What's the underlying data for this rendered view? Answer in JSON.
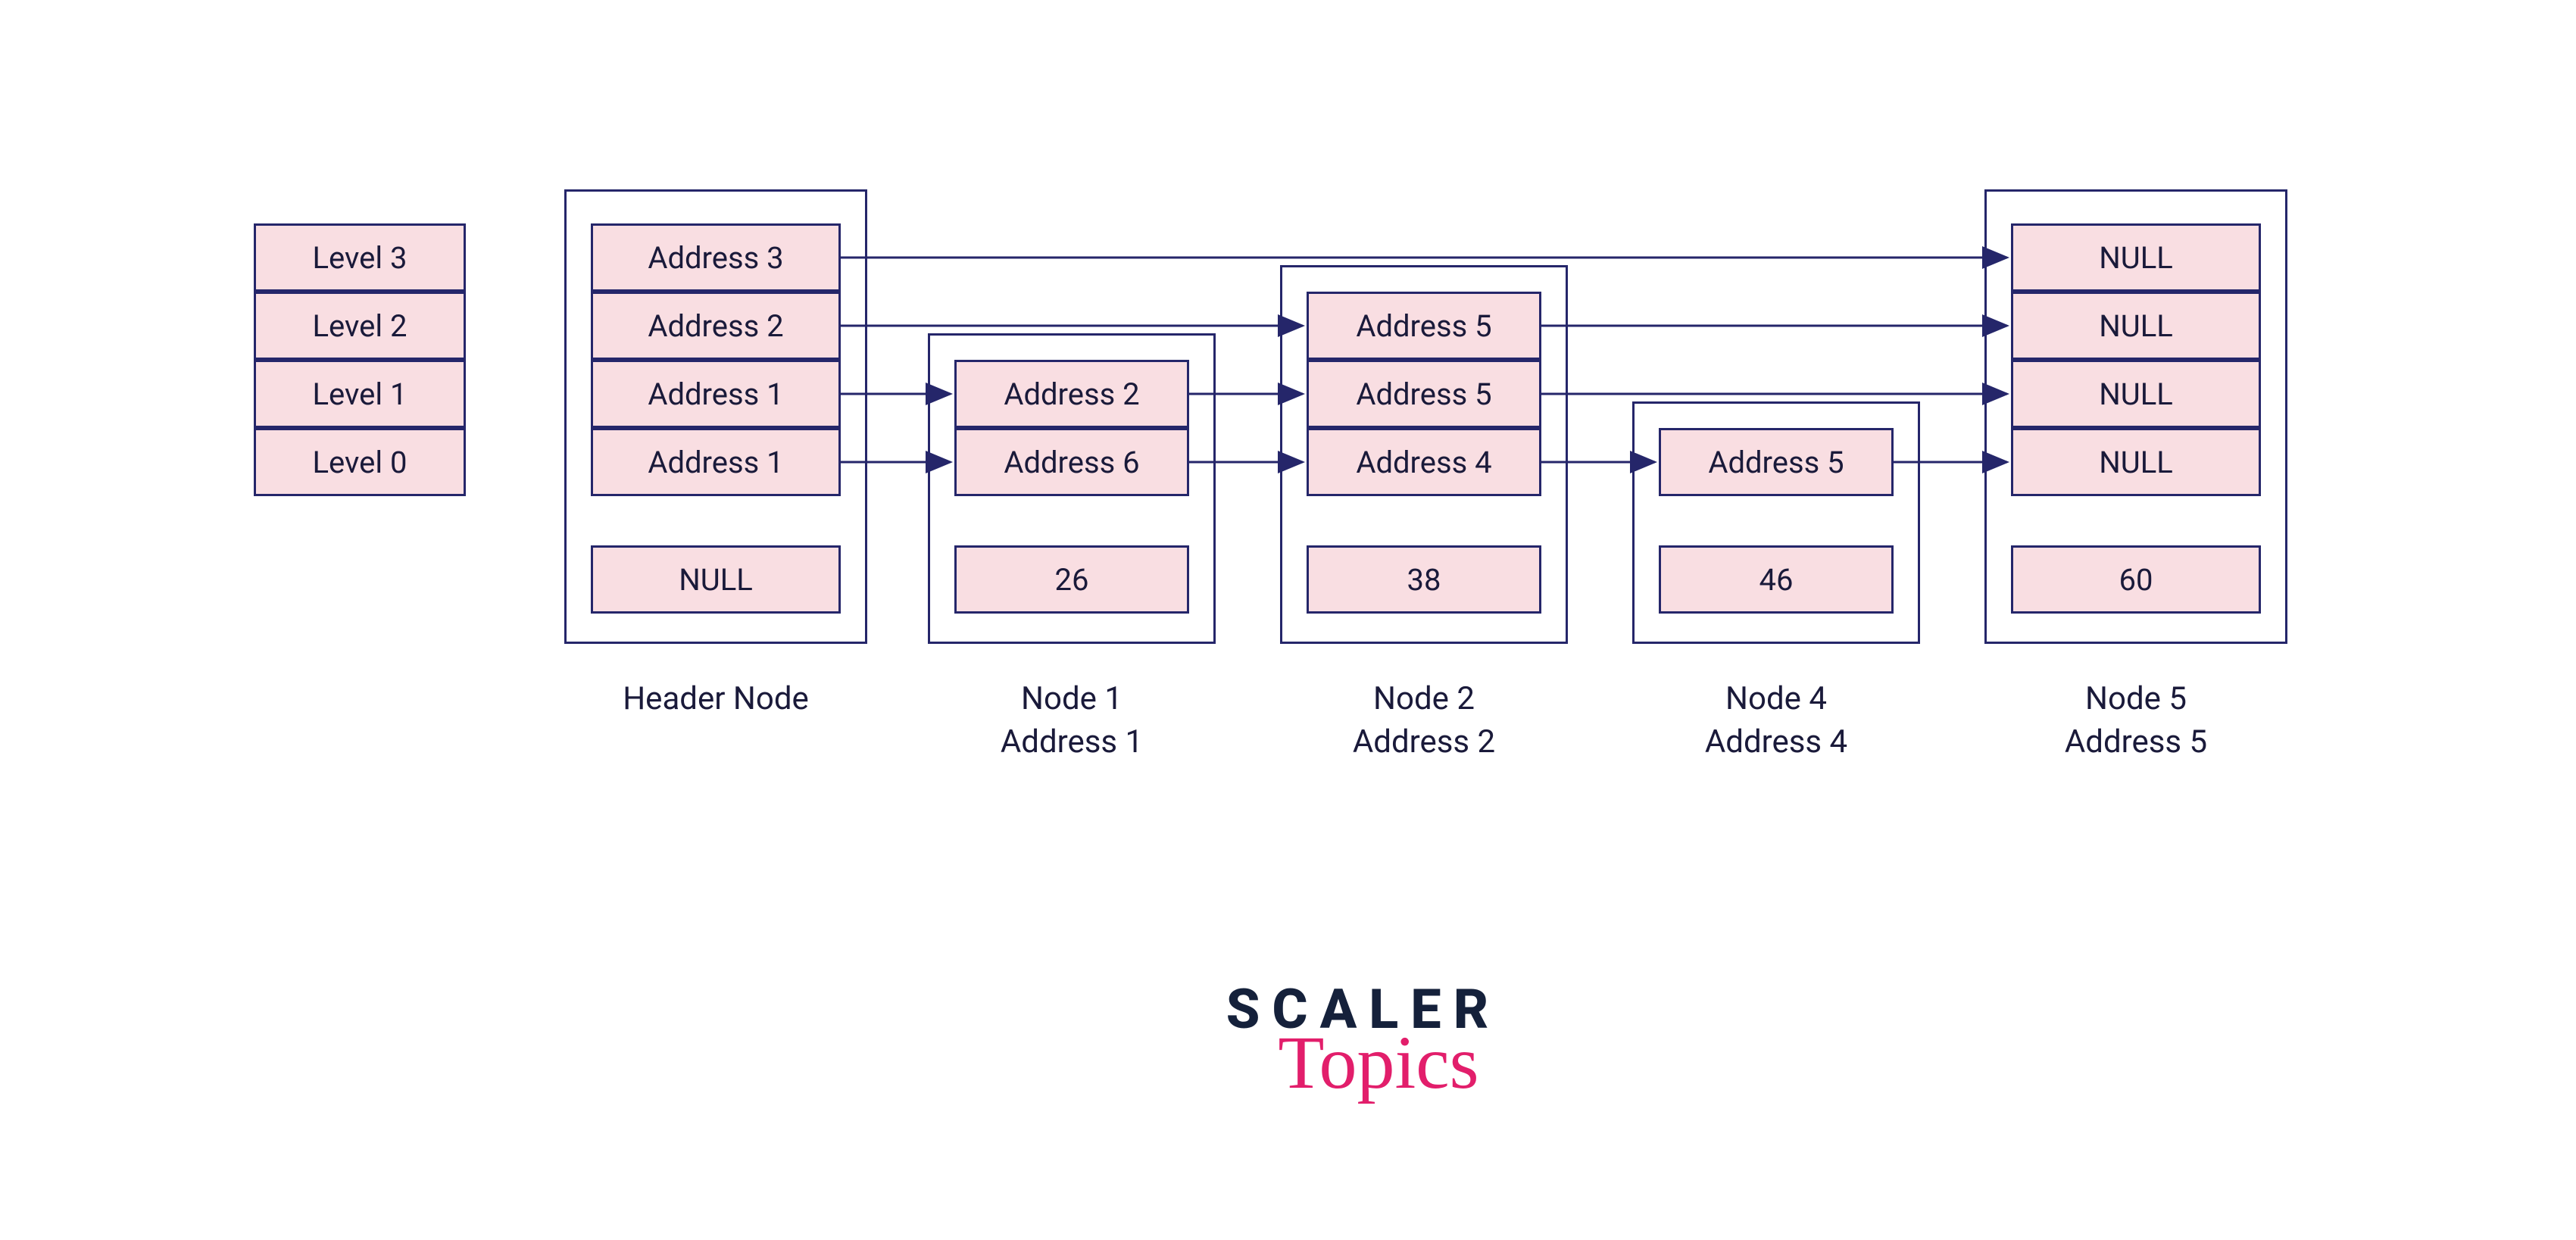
{
  "levels": {
    "cells": [
      "Level 3",
      "Level 2",
      "Level 1",
      "Level 0"
    ]
  },
  "header": {
    "cells": [
      "Address 3",
      "Address 2",
      "Address 1",
      "Address 1"
    ],
    "value": "NULL",
    "caption": "Header Node"
  },
  "node1": {
    "cells": [
      "Address 2",
      "Address 6"
    ],
    "value": "26",
    "caption_line1": "Node 1",
    "caption_line2": "Address 1"
  },
  "node2": {
    "cells": [
      "Address 5",
      "Address 5",
      "Address 4"
    ],
    "value": "38",
    "caption_line1": "Node 2",
    "caption_line2": "Address 2"
  },
  "node4": {
    "cells": [
      "Address 5"
    ],
    "value": "46",
    "caption_line1": "Node 4",
    "caption_line2": "Address 4"
  },
  "node5": {
    "cells": [
      "NULL",
      "NULL",
      "NULL",
      "NULL"
    ],
    "value": "60",
    "caption_line1": "Node 5",
    "caption_line2": "Address 5"
  },
  "logo": {
    "line1": "SCALER",
    "line2": "Topics"
  },
  "colors": {
    "border": "#25266a",
    "cellFill": "#f9dee2",
    "logoDark": "#15213b",
    "logoPink": "#e21e6b"
  }
}
